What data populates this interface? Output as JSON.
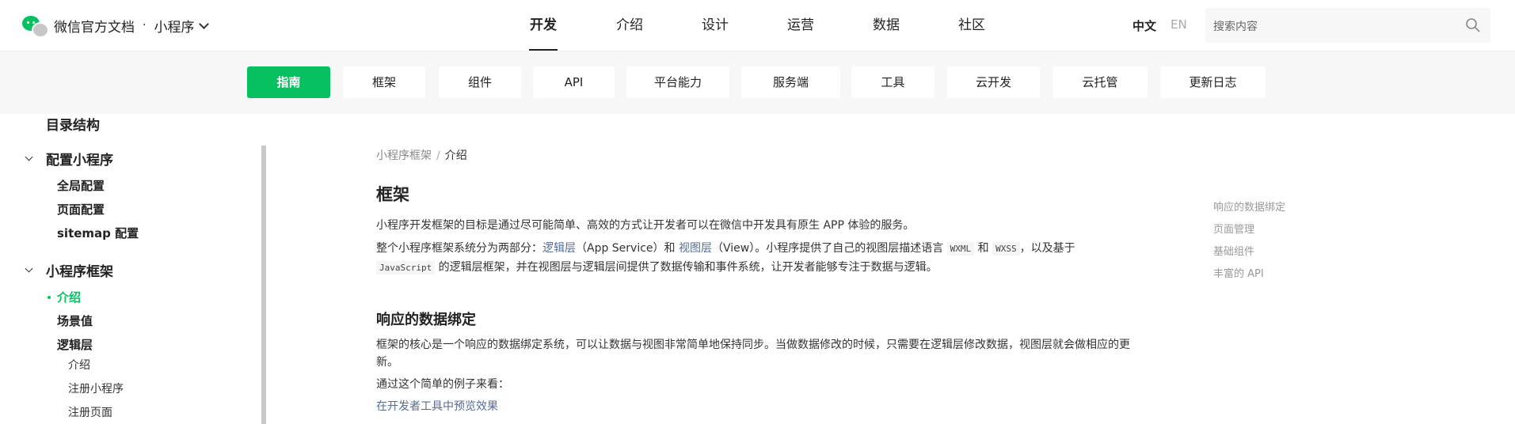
{
  "header": {
    "brand_title": "微信官方文档",
    "brand_sep": "·",
    "brand_sub": "小程序",
    "tabs": [
      "开发",
      "介绍",
      "设计",
      "运营",
      "数据",
      "社区"
    ],
    "active_tab": "开发",
    "lang_zh": "中文",
    "lang_en": "EN",
    "search_placeholder": "搜索内容"
  },
  "subnav": {
    "items": [
      "指南",
      "框架",
      "组件",
      "API",
      "平台能力",
      "服务端",
      "工具",
      "云开发",
      "云托管",
      "更新日志"
    ],
    "active": "指南"
  },
  "sidebar": {
    "top_item": "目录结构",
    "config_section": "配置小程序",
    "config_items": [
      "全局配置",
      "页面配置",
      "sitemap 配置"
    ],
    "framework_section": "小程序框架",
    "framework_items": [
      "介绍",
      "场景值",
      "逻辑层"
    ],
    "logic_sub_items": [
      "介绍",
      "注册小程序",
      "注册页面"
    ]
  },
  "content": {
    "breadcrumb_parent": "小程序框架",
    "breadcrumb_sep": "/",
    "breadcrumb_current": "介绍",
    "title": "框架",
    "p1": "小程序开发框架的目标是通过尽可能简单、高效的方式让开发者可以在微信中开发具有原生 APP 体验的服务。",
    "p2_a": "整个小程序框架系统分为两部分：",
    "p2_link1": "逻辑层",
    "p2_b": "（App Service）和 ",
    "p2_link2": "视图层",
    "p2_c": "（View）。小程序提供了自己的视图层描述语言 ",
    "p2_code1": "WXML",
    "p2_d": " 和 ",
    "p2_code2": "WXSS",
    "p2_e": "，以及基于",
    "p3_code": "JavaScript",
    "p3_rest": " 的逻辑层框架，并在视图层与逻辑层间提供了数据传输和事件系统，让开发者能够专注于数据与逻辑。",
    "h2": "响应的数据绑定",
    "p4_line1": "框架的核心是一个响应的数据绑定系统，可以让数据与视图非常简单地保持同步。当做数据修改的时候，只需要在逻辑层修改数据，视图层就会做相应的更",
    "p4_line2": "新。",
    "p5": "通过这个简单的例子来看：",
    "p6_link": "在开发者工具中预览效果"
  },
  "toc": [
    "响应的数据绑定",
    "页面管理",
    "基础组件",
    "丰富的 API"
  ],
  "colors": {
    "accent": "#07c160",
    "link": "#576b95"
  }
}
